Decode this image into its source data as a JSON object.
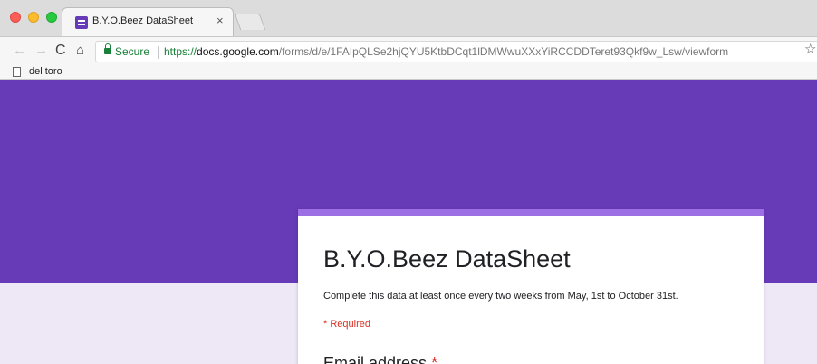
{
  "browser": {
    "tab": {
      "title": "B.Y.O.Beez DataSheet",
      "close": "×"
    },
    "toolbar": {
      "back": "←",
      "forward": "→",
      "reload": "C",
      "home": "⌂",
      "secure_label": "Secure",
      "url_scheme": "https://",
      "url_host": "docs.google.com",
      "url_path": "/forms/d/e/1FAIpQLSe2hjQYU5KtbDCqt1lDMWwuXXxYiRCCDDTeret93Qkf9w_Lsw/viewform",
      "star": "☆"
    },
    "bookmarks": [
      {
        "label": "del toro"
      }
    ]
  },
  "form": {
    "title": "B.Y.O.Beez DataSheet",
    "description": "Complete this data at least once every two weeks from May, 1st to October 31st.",
    "required_note": "* Required",
    "questions": [
      {
        "label": "Email address",
        "required_marker": "*"
      }
    ]
  },
  "colors": {
    "banner": "#673ab7",
    "card_accent": "#9c6fe4",
    "background": "#ede7f6",
    "required": "#d93025",
    "secure": "#188038"
  },
  "icons": {
    "favicon": "google-forms-icon",
    "secure": "lock-icon",
    "bookmark": "page-icon"
  }
}
